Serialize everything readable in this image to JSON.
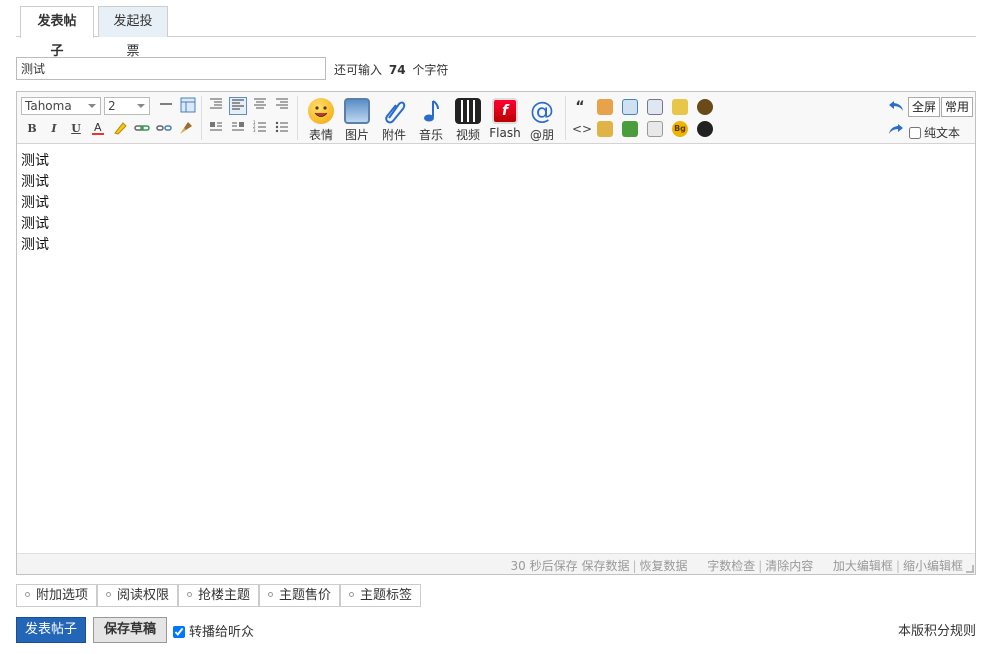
{
  "tabs": [
    {
      "label": "发表帖子",
      "active": true
    },
    {
      "label": "发起投票",
      "active": false
    }
  ],
  "subject": {
    "value": "测试",
    "hint_prefix": "还可输入",
    "hint_count": "74",
    "hint_suffix": "个字符"
  },
  "toolbar": {
    "font_family": "Tahoma",
    "font_size": "2",
    "big_buttons": [
      {
        "label": "表情",
        "icon": "emoji-icon"
      },
      {
        "label": "图片",
        "icon": "image-icon"
      },
      {
        "label": "附件",
        "icon": "paperclip-icon"
      },
      {
        "label": "音乐",
        "icon": "music-note-icon"
      },
      {
        "label": "视频",
        "icon": "video-clapper-icon"
      },
      {
        "label": "Flash",
        "icon": "flash-icon"
      },
      {
        "label": "@朋",
        "icon": "at-mention-icon"
      }
    ],
    "fullscreen_label": "全屏",
    "common_label": "常用",
    "plain_text_label": "纯文本",
    "accent_color": "#2a6ccd"
  },
  "content": {
    "lines": [
      "测试",
      "测试",
      "测试",
      "测试",
      "测试"
    ]
  },
  "statusbar": {
    "autosave": "30 秒后保存",
    "save_data": "保存数据",
    "restore_data": "恢复数据",
    "word_count": "字数检查",
    "clear_content": "清除内容",
    "enlarge": "加大编辑框",
    "shrink": "缩小编辑框"
  },
  "options": [
    {
      "label": "附加选项"
    },
    {
      "label": "阅读权限"
    },
    {
      "label": "抢楼主题"
    },
    {
      "label": "主题售价"
    },
    {
      "label": "主题标签"
    }
  ],
  "bottom": {
    "post_button": "发表帖子",
    "draft_button": "保存草稿",
    "repost_label": "转播给听众",
    "rules_link": "本版积分规则",
    "post_button_color": "#2366b8"
  }
}
